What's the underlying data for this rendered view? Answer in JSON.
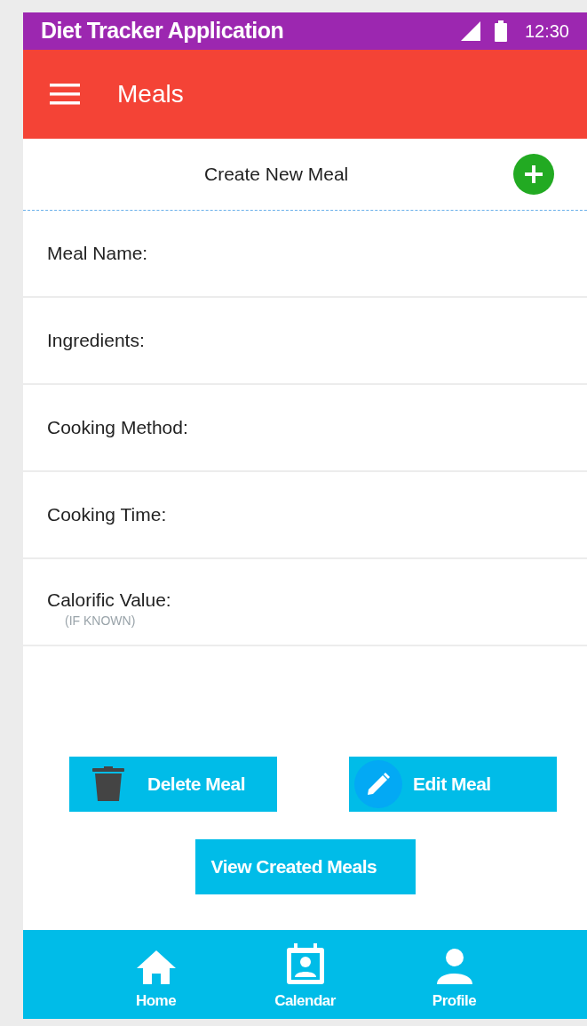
{
  "status_bar": {
    "title": "Diet Tracker Application",
    "time": "12:30"
  },
  "app_bar": {
    "title": "Meals"
  },
  "create": {
    "label": "Create New Meal"
  },
  "fields": [
    {
      "label": "Meal Name:"
    },
    {
      "label": "Ingredients:"
    },
    {
      "label": "Cooking Method:"
    },
    {
      "label": "Cooking Time:"
    },
    {
      "label": "Calorific Value:",
      "hint": "(IF KNOWN)"
    }
  ],
  "buttons": [
    {
      "kind": "delete",
      "label": "Delete Meal"
    },
    {
      "kind": "edit",
      "label": "Edit Meal"
    },
    {
      "kind": "view",
      "label": "View Created Meals"
    }
  ],
  "bottom_nav": [
    {
      "kind": "home",
      "label": "Home"
    },
    {
      "kind": "calendar",
      "label": "Calendar"
    },
    {
      "kind": "profile",
      "label": "Profile"
    }
  ]
}
